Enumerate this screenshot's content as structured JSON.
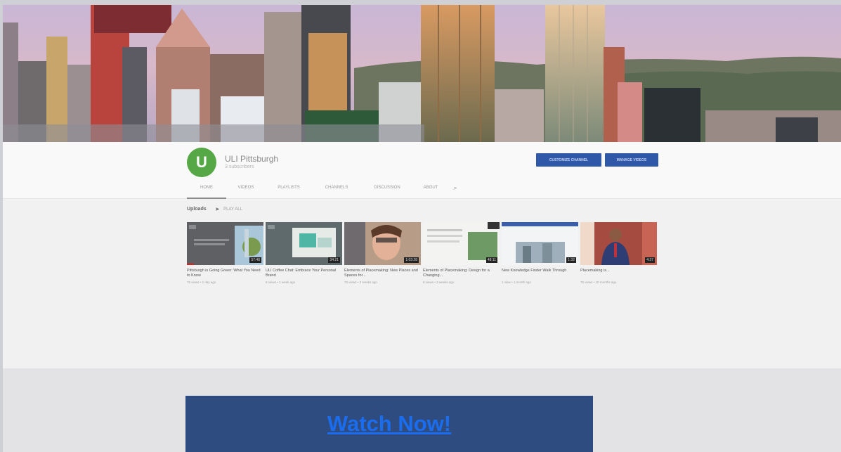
{
  "channel": {
    "avatar_letter": "U",
    "name": "ULI Pittsburgh",
    "subscribers": "3 subscribers",
    "customize_button": "CUSTOMIZE CHANNEL",
    "manage_button": "MANAGE VIDEOS"
  },
  "tabs": [
    {
      "label": "HOME",
      "active": true
    },
    {
      "label": "VIDEOS",
      "active": false
    },
    {
      "label": "PLAYLISTS",
      "active": false
    },
    {
      "label": "CHANNELS",
      "active": false
    },
    {
      "label": "DISCUSSION",
      "active": false
    },
    {
      "label": "ABOUT",
      "active": false
    }
  ],
  "uploads": {
    "heading": "Uploads",
    "play_all": "PLAY ALL"
  },
  "videos": [
    {
      "title": "Pittsburgh is Going Green: What You Need to Know",
      "meta": "76 views • 1 day ago",
      "duration": "57:48"
    },
    {
      "title": "ULI Coffee Chat: Embrace Your Personal Brand",
      "meta": "8 views • 1 week ago",
      "duration": "34:21"
    },
    {
      "title": "Elements of Placemaking: New Places and Spaces for...",
      "meta": "70 views • 3 weeks ago",
      "duration": "1:03:28"
    },
    {
      "title": "Elements of Placemaking: Design for a Changing...",
      "meta": "8 views • 3 weeks ago",
      "duration": "48:11"
    },
    {
      "title": "New Knowledge Finder Walk Through",
      "meta": "1 view • 1 month ago",
      "duration": "1:32"
    },
    {
      "title": "Placemaking is...",
      "meta": "76 views • 10 months ago",
      "duration": "4:37"
    }
  ],
  "cta": {
    "label": "Watch Now!"
  },
  "colors": {
    "cta_bg": "#2e4c7f",
    "cta_link": "#1b6df0",
    "avatar": "#55a845",
    "button": "#2f58a9"
  }
}
